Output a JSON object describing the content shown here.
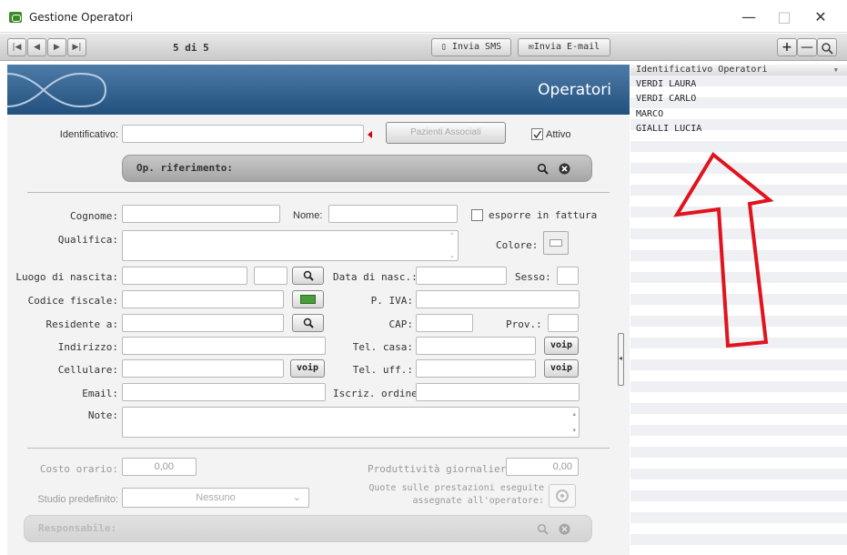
{
  "window": {
    "title": "Gestione Operatori",
    "min": "—",
    "max": "□",
    "close": "✕"
  },
  "toolbar": {
    "nav": [
      "|◀",
      "◀",
      "▶",
      "▶|"
    ],
    "record": "5 di 5",
    "sms": "Invia SMS",
    "email": "Invia E-mail",
    "add": "+",
    "remove": "—",
    "search": "🔍"
  },
  "banner": {
    "title": "Operatori"
  },
  "form": {
    "identificativo": {
      "label": "Identificativo:",
      "value": ""
    },
    "pazienti_associati": "Pazienti Associati",
    "attivo": {
      "label": "Attivo",
      "checked": true
    },
    "op_riferimento": "Op. riferimento:",
    "cognome": {
      "label": "Cognome:",
      "value": ""
    },
    "nome": {
      "label": "Nome:",
      "value": ""
    },
    "esporre": {
      "label": "esporre in fattura",
      "checked": false
    },
    "qualifica": {
      "label": "Qualifica:",
      "value": ""
    },
    "colore": "Colore:",
    "luogo_nascita": "Luogo di nascita:",
    "data_nasc": "Data di nasc.:",
    "sesso": "Sesso:",
    "codice_fiscale": "Codice fiscale:",
    "piva": "P. IVA:",
    "residente": "Residente a:",
    "cap": "CAP:",
    "prov": "Prov.:",
    "indirizzo": "Indirizzo:",
    "tel_casa": "Tel. casa:",
    "cellulare": "Cellulare:",
    "tel_uff": "Tel. uff.:",
    "email": "Email:",
    "iscriz": "Iscriz. ordine:",
    "note": "Note:",
    "voip": "voip",
    "costo_orario": {
      "label": "Costo orario:",
      "value": "0,00"
    },
    "produttivita": {
      "label": "Produttività giornaliera:",
      "value": "0,00"
    },
    "studio": {
      "label": "Studio predefinito:",
      "value": "Nessuno"
    },
    "quote_line1": "Quote sulle prestazioni eseguite",
    "quote_line2": "assegnate all'operatore:",
    "responsabile": "Responsabile:"
  },
  "list": {
    "header": "Identificativo Operatori",
    "items": [
      "VERDI LAURA",
      "VERDI CARLO",
      "MARCO",
      "GIALLI LUCIA"
    ]
  },
  "colors": {
    "banner": "#21507e",
    "annotation_arrow": "#e0141e"
  }
}
